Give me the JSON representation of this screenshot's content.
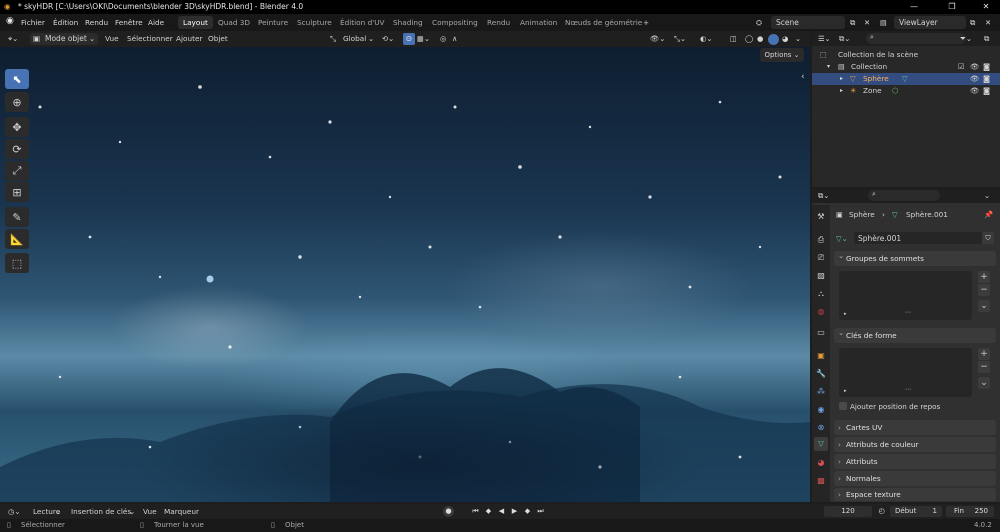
{
  "window": {
    "title": "* skyHDR [C:\\Users\\OKI\\Documents\\blender 3D\\skyHDR.blend] - Blender 4.0",
    "minimize": "—",
    "maximize": "❐",
    "close": "✕"
  },
  "menubar": {
    "menus": [
      "Fichier",
      "Édition",
      "Rendu",
      "Fenêtre",
      "Aide"
    ],
    "workspaces": [
      "Layout",
      "Quad 3D",
      "Peinture",
      "Sculpture",
      "Édition d'UV",
      "Shading",
      "Compositing",
      "Rendu",
      "Animation",
      "Nœuds de géométrie"
    ],
    "active_workspace": "Layout",
    "add_tab": "+",
    "scene_label": "Scene",
    "viewlayer_label": "ViewLayer"
  },
  "viewport_header": {
    "mode": "Mode objet",
    "view": "Vue",
    "select": "Sélectionner",
    "add": "Ajouter",
    "object": "Objet",
    "orientation": "Global"
  },
  "viewport": {
    "options": "Options"
  },
  "outliner": {
    "root": "Collection de la scène",
    "collection": "Collection",
    "items": [
      {
        "label": "Sphère",
        "selected": true
      },
      {
        "label": "Zone",
        "selected": false
      }
    ]
  },
  "properties": {
    "breadcrumb_object": "Sphère",
    "breadcrumb_mesh": "Sphère.001",
    "mesh_name": "Sphère.001",
    "vertex_groups": "Groupes de sommets",
    "shape_keys": "Clés de forme",
    "relative_checkbox": "Ajouter position de repos",
    "panels": [
      "Cartes UV",
      "Attributs de couleur",
      "Attributs",
      "Normales",
      "Espace texture"
    ]
  },
  "timeline": {
    "playback": "Lecture",
    "keying": "Insertion de clés",
    "view": "Vue",
    "marker": "Marqueur",
    "current_frame": "120",
    "start_label": "Début",
    "start_value": "1",
    "end_label": "Fin",
    "end_value": "250"
  },
  "statusbar": {
    "select": "Sélectionner",
    "rotate": "Tourner la vue",
    "object": "Objet",
    "version": "4.0.2"
  },
  "colors": {
    "accent": "#4772b3",
    "selection": "#334d80",
    "mesh_icon": "#5ac0b0",
    "object_icon": "#e49a3c"
  }
}
